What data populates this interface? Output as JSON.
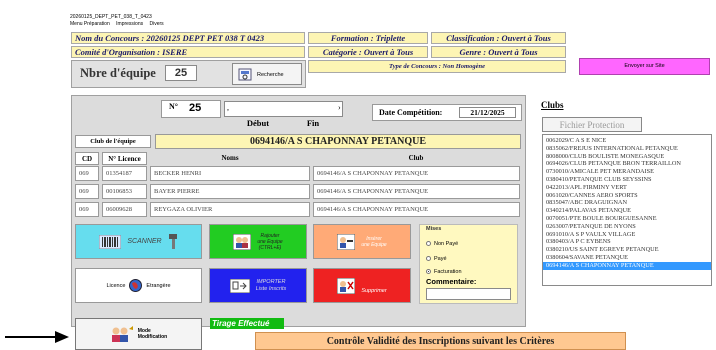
{
  "window": {
    "title": "20260125_DEPT_PET_038_T_0423"
  },
  "menu": {
    "items": [
      "Menu Préparation",
      "Impressions",
      "Divers"
    ]
  },
  "header": {
    "concours": "Nom du Concours : 20260125 DEPT PET 038 T 0423",
    "formation": "Formation : Triplette",
    "classification": "Classification : Ouvert à Tous",
    "comite": "Comité d'Organisation : ISERE",
    "categorie": "Catégorie : Ouvert à Tous",
    "genre": "Genre : Ouvert à Tous",
    "type_concours": "Type de Concours : Non Homogène",
    "nbre_label": "Nbre d'équipe",
    "nbre_value": "25",
    "recherche_label": "Recherche",
    "envoyer_label": "Envoyer sur Site"
  },
  "form": {
    "numero_label": "N°",
    "numero_value": "25",
    "debut_label": "Début",
    "fin_label": "Fin",
    "date_label": "Date Compétition:",
    "date_value": "21/12/2025",
    "club_equipe_label": "Club de l'équipe",
    "club_equipe_value": "0694146/A S  CHAPONNAY PETANQUE"
  },
  "table": {
    "headers": [
      "CD",
      "N° Licence",
      "Noms",
      "Club"
    ],
    "rows": [
      [
        "069",
        "01354187",
        "BECKER HENRI",
        "0694146/A S  CHAPONNAY PETANQUE"
      ],
      [
        "069",
        "00106853",
        "BAYER PIERRE",
        "0694146/A S  CHAPONNAY PETANQUE"
      ],
      [
        "069",
        "06009628",
        "REYGAZA OLIVIER",
        "0694146/A S  CHAPONNAY PETANQUE"
      ]
    ]
  },
  "actions": {
    "scanner": "SCANNER",
    "rajouter_line1": "Rajouter",
    "rajouter_line2": "une Equipe",
    "rajouter_line3": "(CTRL+E)",
    "inserer_line1": "Insérer",
    "inserer_line2": "une Equipe",
    "licence": "Licence",
    "etrangere": "Etrangère",
    "importer_line1": "IMPORTER",
    "importer_line2": "Liste Inscrits",
    "supprimer": "Supprimer",
    "mode_line1": "Mode",
    "mode_line2": "Modification"
  },
  "mises": {
    "title": "Mises",
    "options": [
      "Non Payé",
      "Payé",
      "Facturation"
    ],
    "selected": "Facturation",
    "commentaire_label": "Commentaire:"
  },
  "clubs": {
    "title": "Clubs",
    "fichier_protection": "Fichier Protection",
    "items": [
      "0062029/C A S E  NICE",
      "0835062/FREJUS INTERNATIONAL PETANQUE",
      "8008000/CLUB BOULISTE MONEGASQUE",
      "0694026/CLUB PETANQUE BRON TERRAILLON",
      "0730010/AMICALE PET MERANDAISE",
      "0380410/PETANQUE CLUB SEYSSINS",
      "0422013/APL FIRMINY VERT",
      "0061020/CANNES AERO SPORTS",
      "0835047/ABC DRAGUIGNAN",
      "0340214/PALAVAS PETANQUE",
      "0070051/PTE BOULE BOURGUESANNE",
      "0263007/PETANQUE DE NYONS",
      "0691010/A S P  VAULX VILLAGE",
      "0380403/A P C  EYBENS",
      "0380210/US SAINT EGREVE PETANQUE",
      "0380604/SAVANE PETANQUE",
      "0694146/A S  CHAPONNAY PETANQUE"
    ],
    "selected_index": 16
  },
  "status": {
    "tirage": "Tirage Effectué",
    "controle": "Contrôle Validité des Inscriptions suivant les Critères"
  },
  "colors": {
    "header_bg": "#fdf5b4",
    "header_text": "#1a1a6a",
    "envoyer_bg": "#ff66ff",
    "scanner_bg": "#66ddee",
    "rajouter_bg": "#22cc22",
    "inserer_bg": "#ffaa77",
    "importer_bg": "#2222ee",
    "supprimer_bg": "#ee2222",
    "mises_bg": "#fff9c0",
    "tirage_bg": "#11bb11",
    "controle_bg": "#ffc891",
    "selection": "#3399ff"
  }
}
